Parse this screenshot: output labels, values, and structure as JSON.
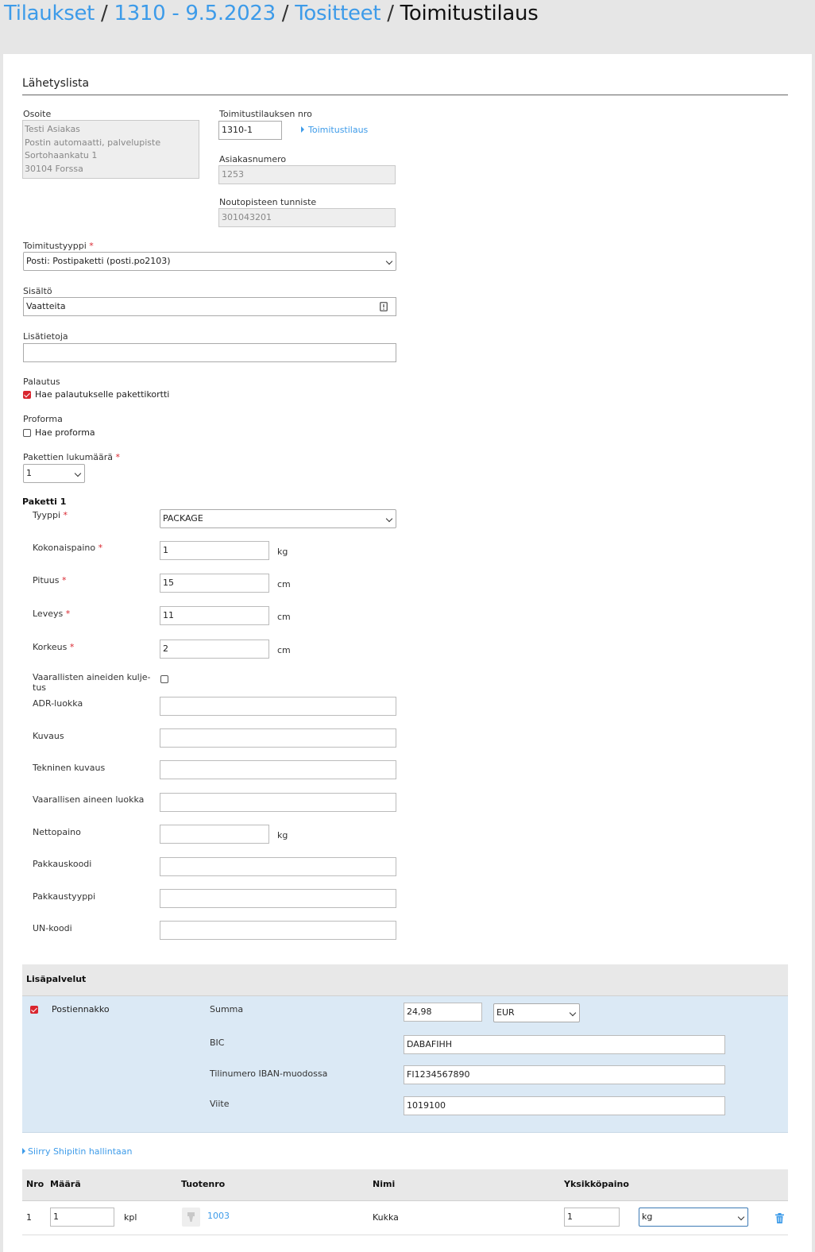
{
  "breadcrumb": {
    "items": [
      "Tilaukset",
      "1310 - 9.5.2023",
      "Tositteet"
    ],
    "current": "Toimitustilaus",
    "separator": "/"
  },
  "section_title": "Lähetyslista",
  "address": {
    "label": "Osoite",
    "lines": [
      "Testi Asiakas",
      "Postin automaatti, palvelupiste",
      "Sortohaankatu 1",
      "30104 Forssa"
    ]
  },
  "delivery_order": {
    "label": "Toimitustilauksen nro",
    "value": "1310-1",
    "link": "Toimitustilaus"
  },
  "customer_number": {
    "label": "Asiakasnumero",
    "value": "1253"
  },
  "pickup_point": {
    "label": "Noutopisteen tunniste",
    "value": "301043201"
  },
  "delivery_type": {
    "label": "Toimitustyyppi",
    "required": "*",
    "value": "Posti: Postipaketti (posti.po2103)"
  },
  "contents": {
    "label": "Sisältö",
    "value": "Vaatteita"
  },
  "additional_info": {
    "label": "Lisätietoja",
    "value": ""
  },
  "return": {
    "label": "Palautus",
    "checkbox_label": "Hae palautukselle pakettikortti",
    "checked": true
  },
  "proforma": {
    "label": "Proforma",
    "checkbox_label": "Hae proforma",
    "checked": false
  },
  "package_count": {
    "label": "Pakettien lukumäärä",
    "required": "*",
    "value": "1"
  },
  "package": {
    "title": "Paketti 1",
    "type": {
      "label": "Tyyppi",
      "value": "PACKAGE"
    },
    "total_weight": {
      "label": "Kokonaispaino",
      "value": "1",
      "unit": "kg"
    },
    "length": {
      "label": "Pituus",
      "value": "15",
      "unit": "cm"
    },
    "width": {
      "label": "Leveys",
      "value": "11",
      "unit": "cm"
    },
    "height": {
      "label": "Korkeus",
      "value": "2",
      "unit": "cm"
    },
    "dangerous_goods": {
      "label_line1": "Vaarallisten aineiden kulje-",
      "label_line2": "tus",
      "checked": false
    },
    "adr_class": {
      "label": "ADR-luokka",
      "value": ""
    },
    "description": {
      "label": "Kuvaus",
      "value": ""
    },
    "technical_description": {
      "label": "Tekninen kuvaus",
      "value": ""
    },
    "dangerous_class": {
      "label": "Vaarallisen aineen luokka",
      "value": ""
    },
    "net_weight": {
      "label": "Nettopaino",
      "value": "",
      "unit": "kg"
    },
    "packing_code": {
      "label": "Pakkauskoodi",
      "value": ""
    },
    "packing_type": {
      "label": "Pakkaustyyppi",
      "value": ""
    },
    "un_code": {
      "label": "UN-koodi",
      "value": ""
    }
  },
  "extra_services": {
    "title": "Lisäpalvelut",
    "service_label": "Postiennakko",
    "checked": true,
    "sum_label": "Summa",
    "sum_value": "24,98",
    "currency": "EUR",
    "bic_label": "BIC",
    "bic_value": "DABAFIHH",
    "iban_label": "Tilinumero IBAN-muodossa",
    "iban_value": "FI1234567890",
    "reference_label": "Viite",
    "reference_value": "1019100"
  },
  "shipit_link": "Siirry Shipitin hallintaan",
  "products_table": {
    "headers": {
      "nro": "Nro",
      "qty": "Määrä",
      "product_no": "Tuotenro",
      "name": "Nimi",
      "unit_weight": "Yksikköpaino"
    },
    "rows": [
      {
        "nro": "1",
        "qty": "1",
        "qty_unit": "kpl",
        "product_no": "1003",
        "name": "Kukka",
        "unit_weight": "1",
        "weight_unit": "kg"
      }
    ]
  },
  "colors": {
    "accent": "#3d9be9",
    "required": "#d9262f",
    "extra_bg": "#dbe9f5"
  }
}
